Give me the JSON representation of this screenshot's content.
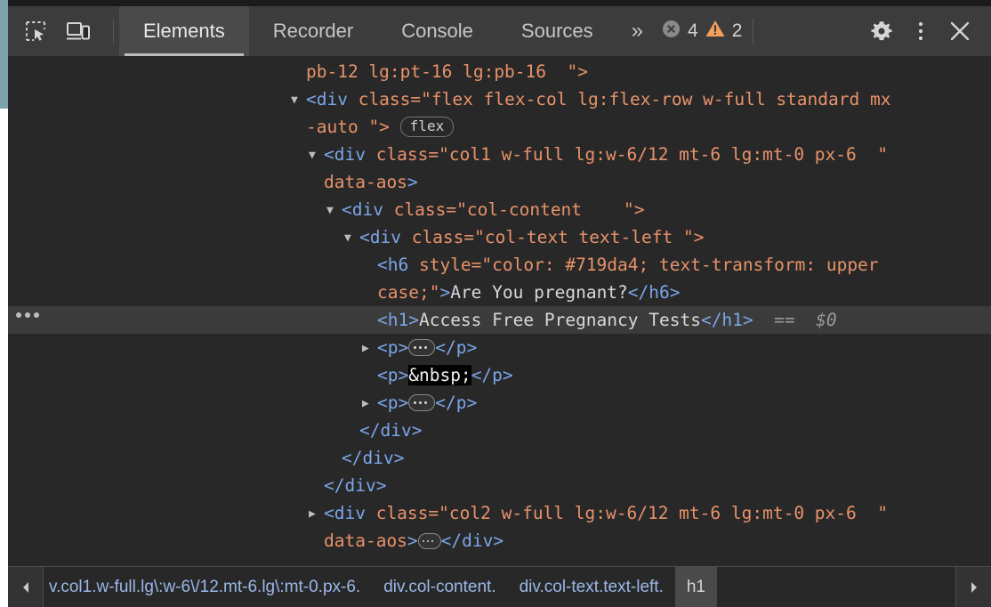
{
  "toolbar": {
    "icons": [
      {
        "name": "inspect-element-icon",
        "label": "Inspect element"
      },
      {
        "name": "device-toolbar-icon",
        "label": "Toggle device toolbar"
      }
    ],
    "tabs": [
      {
        "label": "Elements",
        "active": true
      },
      {
        "label": "Recorder",
        "active": false
      },
      {
        "label": "Console",
        "active": false
      },
      {
        "label": "Sources",
        "active": false
      }
    ],
    "more_tabs_label": "»",
    "errors": {
      "icon": "error-circle-icon",
      "count": "4",
      "color": "#8a8a8a"
    },
    "warnings": {
      "icon": "warning-triangle-icon",
      "count": "2",
      "color": "#f0a05a"
    },
    "settings_label": "Settings",
    "menu_label": "Customize and control DevTools",
    "close_label": "Close DevTools"
  },
  "tree": {
    "rows": [
      {
        "id": "r1",
        "indent": 0,
        "parts": [
          {
            "t": "attr",
            "v": "pb-12 lg:pt-16 lg:pb-16  \">"
          }
        ]
      },
      {
        "id": "r2",
        "indent": 0,
        "twisty": "open",
        "parts": [
          {
            "t": "tag",
            "v": "<div "
          },
          {
            "t": "attr",
            "v": "class="
          },
          {
            "t": "attr",
            "v": "\"flex flex-col lg:flex-row w-full standard mx"
          }
        ]
      },
      {
        "id": "r3",
        "indent": 0,
        "parts": [
          {
            "t": "attr",
            "v": "-auto \">"
          },
          {
            "t": "pill",
            "v": "flex"
          }
        ]
      },
      {
        "id": "r4",
        "indent": 1,
        "twisty": "open",
        "parts": [
          {
            "t": "tag",
            "v": "<div "
          },
          {
            "t": "attr",
            "v": "class="
          },
          {
            "t": "attr",
            "v": "\"col1 w-full lg:w-6/12 mt-6 lg:mt-0 px-6  \""
          }
        ]
      },
      {
        "id": "r5",
        "indent": 1,
        "parts": [
          {
            "t": "attr",
            "v": "data-aos"
          },
          {
            "t": "punc",
            "v": ">"
          }
        ]
      },
      {
        "id": "r6",
        "indent": 2,
        "twisty": "open",
        "parts": [
          {
            "t": "tag",
            "v": "<div "
          },
          {
            "t": "attr",
            "v": "class="
          },
          {
            "t": "attr",
            "v": "\"col-content    \">"
          }
        ]
      },
      {
        "id": "r7",
        "indent": 3,
        "twisty": "open",
        "parts": [
          {
            "t": "tag",
            "v": "<div "
          },
          {
            "t": "attr",
            "v": "class="
          },
          {
            "t": "attr",
            "v": "\"col-text text-left \">"
          }
        ]
      },
      {
        "id": "r8",
        "indent": 4,
        "parts": [
          {
            "t": "tag",
            "v": "<h6 "
          },
          {
            "t": "attr",
            "v": "style="
          },
          {
            "t": "attr",
            "v": "\"color: #719da4; text-transform: upper"
          }
        ]
      },
      {
        "id": "r9",
        "indent": 4,
        "parts": [
          {
            "t": "attr",
            "v": "case;\""
          },
          {
            "t": "punc",
            "v": ">"
          },
          {
            "t": "txt",
            "v": "Are You pregnant?"
          },
          {
            "t": "tag",
            "v": "</h6>"
          }
        ]
      },
      {
        "id": "r10",
        "indent": 4,
        "selected": true,
        "dots": true,
        "parts": [
          {
            "t": "tag",
            "v": "<h1>"
          },
          {
            "t": "txt",
            "v": "Access Free Pregnancy Tests"
          },
          {
            "t": "tag",
            "v": "</h1>"
          },
          {
            "t": "sel0",
            "v": "  ==  $0"
          }
        ]
      },
      {
        "id": "r11",
        "indent": 4,
        "twisty": "closed",
        "parts": [
          {
            "t": "tag",
            "v": "<p>"
          },
          {
            "t": "ellipsis",
            "v": ""
          },
          {
            "t": "tag",
            "v": "</p>"
          }
        ]
      },
      {
        "id": "r12",
        "indent": 4,
        "parts": [
          {
            "t": "tag",
            "v": "<p>"
          },
          {
            "t": "nbsp",
            "v": "&nbsp;"
          },
          {
            "t": "tag",
            "v": "</p>"
          }
        ]
      },
      {
        "id": "r13",
        "indent": 4,
        "twisty": "closed",
        "parts": [
          {
            "t": "tag",
            "v": "<p>"
          },
          {
            "t": "ellipsis",
            "v": ""
          },
          {
            "t": "tag",
            "v": "</p>"
          }
        ]
      },
      {
        "id": "r14",
        "indent": 3,
        "parts": [
          {
            "t": "tag",
            "v": "</div>"
          }
        ]
      },
      {
        "id": "r15",
        "indent": 2,
        "parts": [
          {
            "t": "tag",
            "v": "</div>"
          }
        ]
      },
      {
        "id": "r16",
        "indent": 1,
        "parts": [
          {
            "t": "tag",
            "v": "</div>"
          }
        ]
      },
      {
        "id": "r17",
        "indent": 1,
        "twisty": "closed",
        "parts": [
          {
            "t": "tag",
            "v": "<div "
          },
          {
            "t": "attr",
            "v": "class="
          },
          {
            "t": "attr",
            "v": "\"col2 w-full lg:w-6/12 mt-6 lg:mt-0 px-6  \""
          }
        ]
      },
      {
        "id": "r18",
        "indent": 1,
        "parts": [
          {
            "t": "attr",
            "v": "data-aos"
          },
          {
            "t": "punc",
            "v": ">"
          },
          {
            "t": "ellipsis-sm",
            "v": ""
          },
          {
            "t": "tag",
            "v": "</div>"
          }
        ]
      }
    ]
  },
  "breadcrumb": {
    "scroll_left_label": "◀",
    "scroll_right_label": "▶",
    "items": [
      {
        "label": "v.col1.w-full.lg\\:w-6\\/12.mt-6.lg\\:mt-0.px-6.",
        "current": false,
        "clipped": true
      },
      {
        "label": "div.col-content.",
        "current": false,
        "clipped": false
      },
      {
        "label": "div.col-text.text-left.",
        "current": false,
        "clipped": false
      },
      {
        "label": "h1",
        "current": true,
        "clipped": false
      }
    ]
  }
}
